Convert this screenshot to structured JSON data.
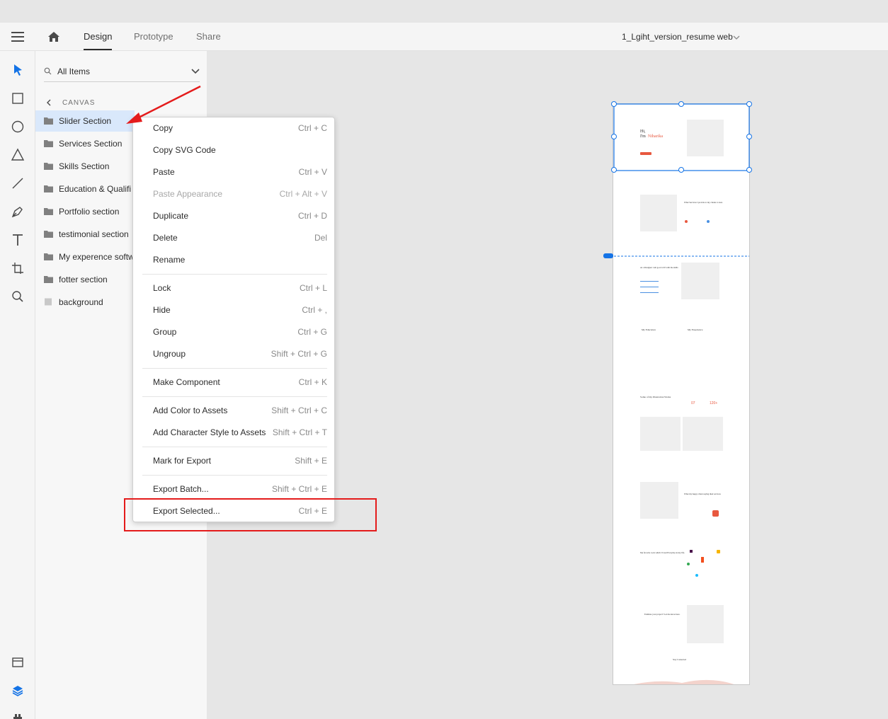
{
  "topbar": {
    "tabs": [
      {
        "label": "Design",
        "active": true
      },
      {
        "label": "Prototype",
        "active": false
      },
      {
        "label": "Share",
        "active": false
      }
    ],
    "document_title": "1_Lgiht_version_resume web"
  },
  "toolbar": {
    "tools": [
      "select-tool-icon",
      "rectangle-tool-icon",
      "ellipse-tool-icon",
      "polygon-tool-icon",
      "line-tool-icon",
      "pen-tool-icon",
      "text-tool-icon",
      "artboard-tool-icon",
      "zoom-tool-icon"
    ],
    "bottom": [
      "assets-icon",
      "layers-icon",
      "plugins-icon"
    ],
    "accent": "#1473e6"
  },
  "layers": {
    "search_label": "All Items",
    "canvas_label": "CANVAS",
    "items": [
      {
        "label": "Slider Section",
        "selected": true
      },
      {
        "label": "Services Section"
      },
      {
        "label": "Skills Section"
      },
      {
        "label": "Education & Qualifi"
      },
      {
        "label": "Portfolio section"
      },
      {
        "label": "testimonial section"
      },
      {
        "label": "My experence softw"
      },
      {
        "label": "fotter section"
      },
      {
        "label": "background"
      }
    ]
  },
  "context_menu": {
    "items": [
      {
        "label": "Copy",
        "shortcut": "Ctrl + C"
      },
      {
        "label": "Copy SVG Code",
        "shortcut": ""
      },
      {
        "label": "Paste",
        "shortcut": "Ctrl + V"
      },
      {
        "label": "Paste Appearance",
        "shortcut": "Ctrl + Alt + V",
        "disabled": true
      },
      {
        "label": "Duplicate",
        "shortcut": "Ctrl + D"
      },
      {
        "label": "Delete",
        "shortcut": "Del"
      },
      {
        "label": "Rename",
        "shortcut": ""
      },
      {
        "label": "Lock",
        "shortcut": "Ctrl + L"
      },
      {
        "label": "Hide",
        "shortcut": "Ctrl + ,"
      },
      {
        "label": "Group",
        "shortcut": "Ctrl + G"
      },
      {
        "label": "Ungroup",
        "shortcut": "Shift + Ctrl + G"
      },
      {
        "label": "Make Component",
        "shortcut": "Ctrl + K"
      },
      {
        "label": "Add Color to Assets",
        "shortcut": "Shift + Ctrl + C"
      },
      {
        "label": "Add Character Style to Assets",
        "shortcut": "Shift + Ctrl + T"
      },
      {
        "label": "Mark for Export",
        "shortcut": "Shift + E"
      },
      {
        "label": "Export Batch...",
        "shortcut": "Shift + Ctrl + E"
      },
      {
        "label": "Export Selected...",
        "shortcut": "Ctrl + E"
      }
    ]
  },
  "artboard": {
    "hero_greeting": "Hi,",
    "hero_name_prefix": "I'm",
    "hero_name": "Niharika",
    "services_heading": "What Services I provide to my clients to best.",
    "skills_heading": "As a Designer i am good at ill with the skills",
    "education_heading": "My Education",
    "experience_heading": "My Experience",
    "portfolio_heading": "Some of my Illustration Works",
    "testimonial_heading": "What my happy client saying their services",
    "tools_heading": "My favorite tools which I Used Everyday in my life.",
    "contact_heading": "Estimate your project? Let me know here.",
    "footer_heading": "Stay Connected",
    "stat_1": "07",
    "stat_2": "120+",
    "accent": "#e8583f"
  }
}
